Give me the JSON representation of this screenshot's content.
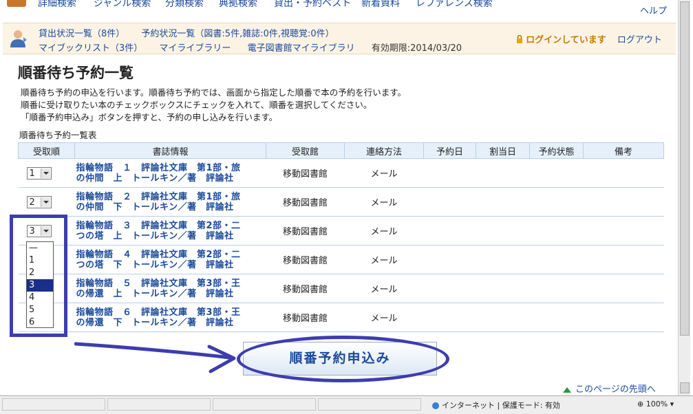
{
  "topnav": {
    "items": [
      "詳細検索",
      "ジャンル検索",
      "分類検索",
      "典拠検索",
      "貸出・予約ベスト",
      "新着資料",
      "レファレンス検索"
    ],
    "help": "ヘルプ"
  },
  "userbar": {
    "loans": "貸出状況一覧（8件）",
    "reservations": "予約状況一覧（図書:5件,雑誌:0件,視聴覚:0件）",
    "mybooklist": "マイブックリスト（3件）",
    "mylibrary": "マイライブラリー",
    "ebooklibrary": "電子図書館マイライブラリ",
    "expiry": "有効期限:2014/03/20",
    "login_status": "ログインしています",
    "logout": "ログアウト"
  },
  "page": {
    "title": "順番待ち予約一覧",
    "description": [
      "順番待ち予約の申込を行います。順番待ち予約では、画面から指定した順番で本の予約を行います。",
      "順番に受け取りたい本のチェックボックスにチェックを入れて、順番を選択してください。",
      "「順番予約申込み」ボタンを押すと、予約の申し込みを行います。"
    ],
    "table_caption": "順番待ち予約一覧表"
  },
  "table": {
    "headers": [
      "受取順",
      "書誌情報",
      "受取館",
      "連絡方法",
      "予約日",
      "割当日",
      "予約状態",
      "備考"
    ],
    "rows": [
      {
        "order": "1",
        "title_line1": "指輪物語　１　評論社文庫　第1部・旅",
        "title_line2": "の仲間　上　トールキン／著　評論社",
        "library": "移動図書館",
        "contact": "メール"
      },
      {
        "order": "2",
        "title_line1": "指輪物語　２　評論社文庫　第1部・旅",
        "title_line2": "の仲間　下　トールキン／著　評論社",
        "library": "移動図書館",
        "contact": "メール"
      },
      {
        "order": "3",
        "title_line1": "指輪物語　３　評論社文庫　第2部・二",
        "title_line2": "つの塔　上　トールキン／著　評論社",
        "library": "移動図書館",
        "contact": "メール"
      },
      {
        "order": "",
        "title_line1": "指輪物語　４　評論社文庫　第2部・二",
        "title_line2": "つの塔　下　トールキン／著　評論社",
        "library": "移動図書館",
        "contact": "メール"
      },
      {
        "order": "",
        "title_line1": "指輪物語　５　評論社文庫　第3部・王",
        "title_line2": "の帰還　上　トールキン／著　評論社",
        "library": "移動図書館",
        "contact": "メール"
      },
      {
        "order": "",
        "title_line1": "指輪物語　６　評論社文庫　第3部・王",
        "title_line2": "の帰還　下　トールキン／著　評論社",
        "library": "移動図書館",
        "contact": "メール"
      }
    ]
  },
  "dropdown": {
    "options": [
      "—",
      "1",
      "2",
      "3",
      "4",
      "5",
      "6"
    ],
    "selected": "3"
  },
  "submit_label": "順番予約申込み",
  "pagetop": "このページの先頭へ",
  "statusbar": {
    "zone": "インターネット | 保護モード: 有効",
    "zoom": "100%"
  },
  "colors": {
    "annotation": "#3d3db0",
    "link": "#1a4a9a",
    "header_bg": "#e6f0fa",
    "userbar_bg": "#fdf3e4"
  }
}
